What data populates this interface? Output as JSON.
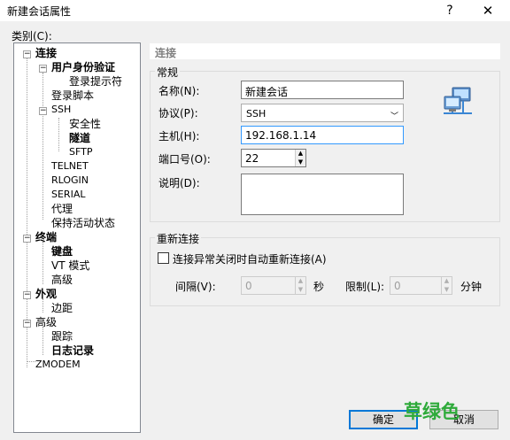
{
  "window": {
    "title": "新建会话属性",
    "help": "?",
    "close": "✕"
  },
  "category_label": "类别(C):",
  "tree": {
    "connection": "连接",
    "user_auth": "用户身份验证",
    "login_prompts": "登录提示符",
    "login_script": "登录脚本",
    "ssh": "SSH",
    "security": "安全性",
    "tunnel": "隧道",
    "sftp": "SFTP",
    "telnet": "TELNET",
    "rlogin": "RLOGIN",
    "serial": "SERIAL",
    "proxy": "代理",
    "keepalive": "保持活动状态",
    "terminal": "终端",
    "keyboard": "键盘",
    "vt_mode": "VT 模式",
    "advanced_term": "高级",
    "appearance": "外观",
    "margin": "边距",
    "advanced": "高级",
    "trace": "跟踪",
    "logging": "日志记录",
    "zmodem": "ZMODEM"
  },
  "section_title": "连接",
  "general": {
    "title": "常规",
    "name_label": "名称(N):",
    "name_value": "新建会话",
    "protocol_label": "协议(P):",
    "protocol_value": "SSH",
    "host_label": "主机(H):",
    "host_value": "192.168.1.14",
    "port_label": "端口号(O):",
    "port_value": "22",
    "desc_label": "说明(D):",
    "desc_value": ""
  },
  "reconnect": {
    "title": "重新连接",
    "checkbox_label": "连接异常关闭时自动重新连接(A)",
    "checked": false,
    "interval_label": "间隔(V):",
    "interval_value": "0",
    "seconds_unit": "秒",
    "limit_label": "限制(L):",
    "limit_value": "0",
    "minutes_unit": "分钟"
  },
  "buttons": {
    "ok": "确定",
    "cancel": "取消"
  },
  "watermark": "草绿色",
  "icons": {
    "network": "network-computers-icon"
  },
  "colors": {
    "focus_border": "#3399ff",
    "default_button": "#0078d7",
    "watermark": "#2eaa3a"
  }
}
